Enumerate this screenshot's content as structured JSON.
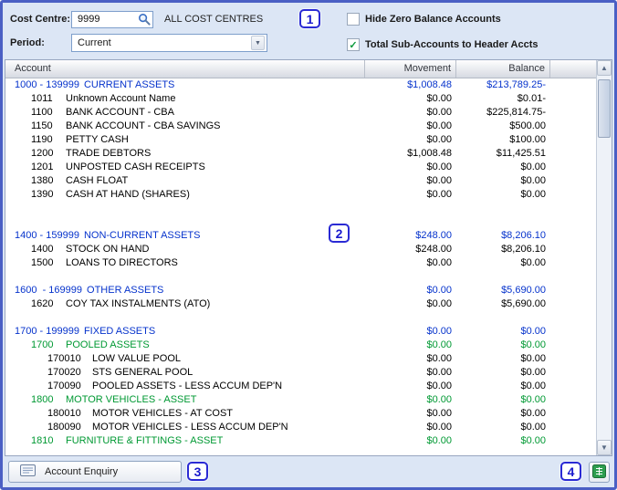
{
  "filters": {
    "cost_centre_label": "Cost Centre:",
    "cost_centre_value": "9999",
    "cost_centre_description": "ALL COST CENTRES",
    "period_label": "Period:",
    "period_value": "Current",
    "hide_zero_label": "Hide Zero Balance Accounts",
    "hide_zero_checked": false,
    "total_sub_label": "Total Sub-Accounts to Header Accts",
    "total_sub_checked": true
  },
  "table": {
    "columns": [
      "Account",
      "Movement",
      "Balance"
    ],
    "rows": [
      {
        "style": "header",
        "level": 0,
        "code": "1000 - 139999",
        "name": "CURRENT ASSETS",
        "movement": "$1,008.48",
        "balance": "$213,789.25-"
      },
      {
        "style": "detail",
        "level": 1,
        "code": "1011",
        "name": "Unknown Account Name",
        "movement": "$0.00",
        "balance": "$0.01-"
      },
      {
        "style": "detail",
        "level": 1,
        "code": "1100",
        "name": "BANK ACCOUNT - CBA",
        "movement": "$0.00",
        "balance": "$225,814.75-"
      },
      {
        "style": "detail",
        "level": 1,
        "code": "1150",
        "name": "BANK ACCOUNT - CBA SAVINGS",
        "movement": "$0.00",
        "balance": "$500.00"
      },
      {
        "style": "detail",
        "level": 1,
        "code": "1190",
        "name": "PETTY CASH",
        "movement": "$0.00",
        "balance": "$100.00"
      },
      {
        "style": "detail",
        "level": 1,
        "code": "1200",
        "name": "TRADE DEBTORS",
        "movement": "$1,008.48",
        "balance": "$11,425.51"
      },
      {
        "style": "detail",
        "level": 1,
        "code": "1201",
        "name": "UNPOSTED CASH RECEIPTS",
        "movement": "$0.00",
        "balance": "$0.00"
      },
      {
        "style": "detail",
        "level": 1,
        "code": "1380",
        "name": "CASH FLOAT",
        "movement": "$0.00",
        "balance": "$0.00"
      },
      {
        "style": "detail",
        "level": 1,
        "code": "1390",
        "name": "CASH AT HAND (SHARES)",
        "movement": "$0.00",
        "balance": "$0.00"
      },
      {
        "style": "blank"
      },
      {
        "style": "blank"
      },
      {
        "style": "header",
        "level": 0,
        "code": "1400 - 159999",
        "name": "NON-CURRENT ASSETS",
        "movement": "$248.00",
        "balance": "$8,206.10"
      },
      {
        "style": "detail",
        "level": 1,
        "code": "1400",
        "name": "STOCK ON HAND",
        "movement": "$248.00",
        "balance": "$8,206.10"
      },
      {
        "style": "detail",
        "level": 1,
        "code": "1500",
        "name": "LOANS TO DIRECTORS",
        "movement": "$0.00",
        "balance": "$0.00"
      },
      {
        "style": "blank"
      },
      {
        "style": "header",
        "level": 0,
        "code": "1600  - 169999",
        "name": "OTHER ASSETS",
        "movement": "$0.00",
        "balance": "$5,690.00"
      },
      {
        "style": "detail",
        "level": 1,
        "code": "1620",
        "name": "COY TAX INSTALMENTS (ATO)",
        "movement": "$0.00",
        "balance": "$5,690.00"
      },
      {
        "style": "blank"
      },
      {
        "style": "header",
        "level": 0,
        "code": "1700 - 199999",
        "name": "FIXED ASSETS",
        "movement": "$0.00",
        "balance": "$0.00"
      },
      {
        "style": "sub",
        "level": 1,
        "code": "1700",
        "name": "POOLED ASSETS",
        "movement": "$0.00",
        "balance": "$0.00"
      },
      {
        "style": "detail",
        "level": 2,
        "code": "170010",
        "name": "LOW VALUE POOL",
        "movement": "$0.00",
        "balance": "$0.00"
      },
      {
        "style": "detail",
        "level": 2,
        "code": "170020",
        "name": "STS GENERAL POOL",
        "movement": "$0.00",
        "balance": "$0.00"
      },
      {
        "style": "detail",
        "level": 2,
        "code": "170090",
        "name": "POOLED ASSETS - LESS ACCUM DEP'N",
        "movement": "$0.00",
        "balance": "$0.00"
      },
      {
        "style": "sub",
        "level": 1,
        "code": "1800",
        "name": "MOTOR VEHICLES - ASSET",
        "movement": "$0.00",
        "balance": "$0.00"
      },
      {
        "style": "detail",
        "level": 2,
        "code": "180010",
        "name": "MOTOR VEHICLES - AT COST",
        "movement": "$0.00",
        "balance": "$0.00"
      },
      {
        "style": "detail",
        "level": 2,
        "code": "180090",
        "name": "MOTOR VEHICLES - LESS ACCUM DEP'N",
        "movement": "$0.00",
        "balance": "$0.00"
      },
      {
        "style": "sub",
        "level": 1,
        "code": "1810",
        "name": "FURNITURE & FITTINGS - ASSET",
        "movement": "$0.00",
        "balance": "$0.00"
      }
    ]
  },
  "footer": {
    "account_enquiry_label": "Account Enquiry"
  },
  "annotations": {
    "a1": "1",
    "a2": "2",
    "a3": "3",
    "a4": "4"
  },
  "icons": {
    "scroll_up": "▲",
    "scroll_down": "▼",
    "dropdown_arrow": "▼",
    "checkmark": "✓"
  },
  "colors": {
    "window_border": "#4a5fc4",
    "header_account_text": "#0633cc",
    "sub_account_text": "#009933",
    "check_green": "#0a9a3c",
    "annotation_blue": "#1a1acd"
  }
}
